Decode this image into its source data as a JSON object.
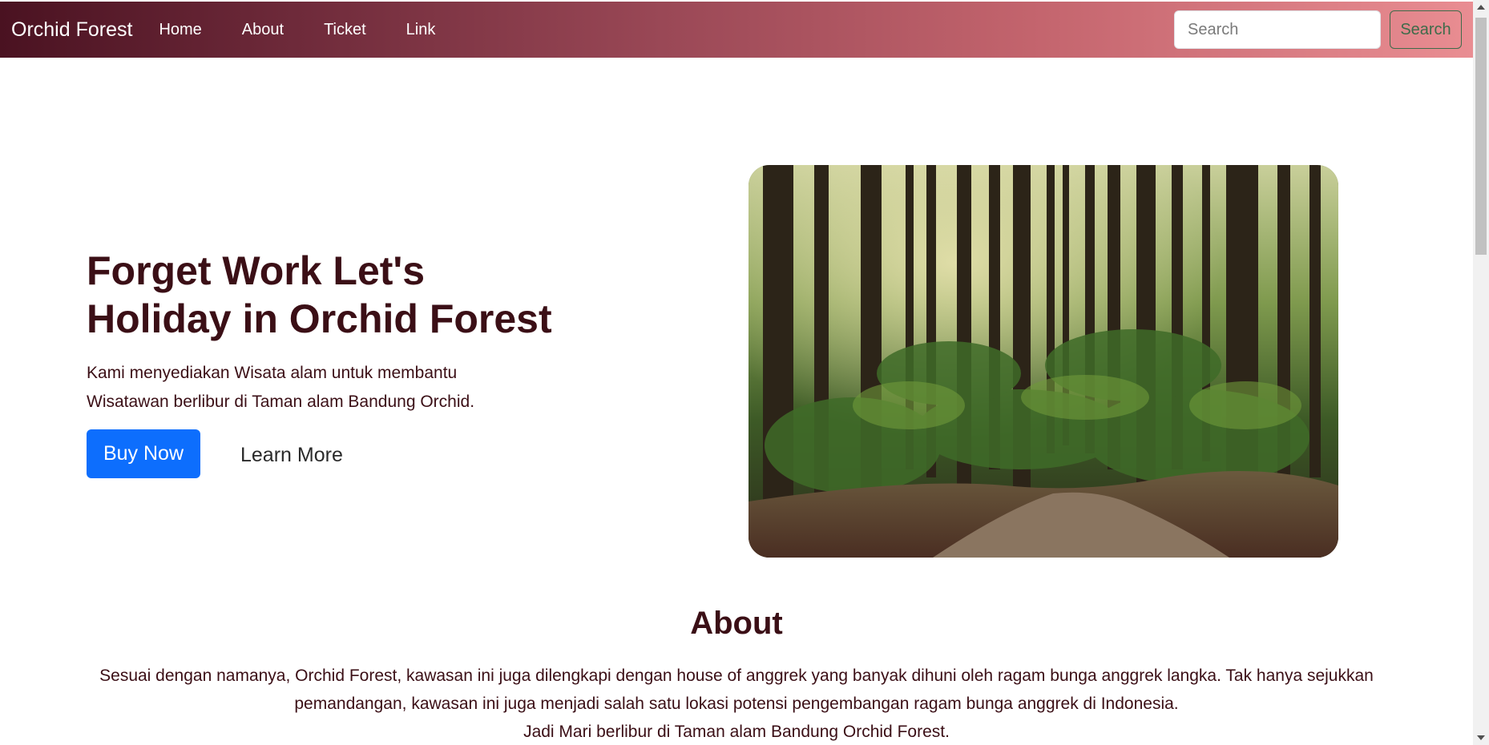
{
  "navbar": {
    "brand": "Orchid Forest",
    "links": [
      "Home",
      "About",
      "Ticket",
      "Link"
    ],
    "search_placeholder": "Search",
    "search_button": "Search"
  },
  "hero": {
    "title_part1": "Forget Work ",
    "title_hl1": "Let's",
    "title_hl2": "Holiday",
    "title_part2": " in Orchid Forest",
    "description": "Kami menyediakan Wisata alam untuk membantu Wisatawan berlibur di Taman alam Bandung Orchid.",
    "buy_button": "Buy Now",
    "learn_button": "Learn More",
    "image_icon": "forest-path-photo"
  },
  "about": {
    "title": "About",
    "line1": "Sesuai dengan namanya, Orchid Forest, kawasan ini juga dilengkapi dengan house of anggrek yang banyak dihuni oleh ragam bunga anggrek langka. Tak hanya sejukkan pemandangan, kawasan ini juga menjadi salah satu lokasi potensi pengembangan ragam bunga anggrek di Indonesia.",
    "line2": "Jadi Mari berlibur di Taman alam Bandung Orchid Forest."
  },
  "colors": {
    "accent_dark": "#3b0f16",
    "highlight": "#1ab0ec",
    "primary_button": "#0d6efd",
    "search_button": "#3e6b4a"
  }
}
